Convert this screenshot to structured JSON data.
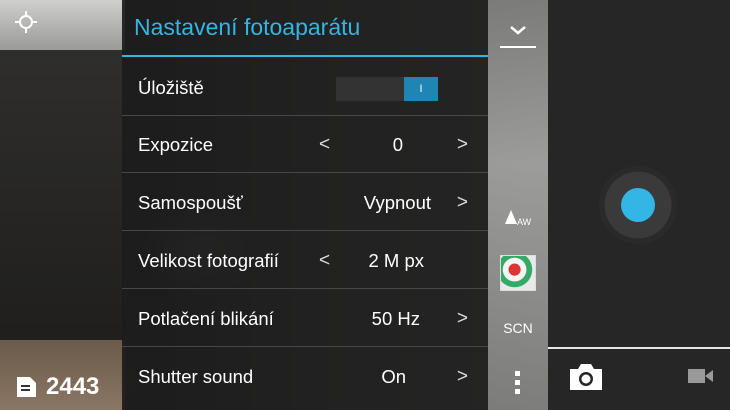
{
  "panel": {
    "title": "Nastavení fotoaparátu",
    "rows": [
      {
        "label": "Úložiště",
        "control": "switch",
        "switch_text": "I"
      },
      {
        "label": "Expozice",
        "value": "0",
        "prev": "<",
        "next": ">"
      },
      {
        "label": "Samospoušť",
        "value": "Vypnout",
        "next": ">"
      },
      {
        "label": "Velikost fotografií",
        "value": "2 M px",
        "prev": "<"
      },
      {
        "label": "Potlačení blikání",
        "value": "50 Hz",
        "next": ">"
      },
      {
        "label": "Shutter sound",
        "value": "On",
        "next": ">"
      }
    ]
  },
  "status": {
    "remaining_shots": "2443"
  },
  "strip": {
    "scene_label": "SCN",
    "white_balance_label": "AW"
  },
  "colors": {
    "accent": "#33b5e5",
    "panel_bg": "#1c1c1c"
  },
  "icons": [
    "focus-icon",
    "sd-card-icon",
    "chevron-down-icon",
    "white-balance-icon",
    "color-effect-thumbnail",
    "more-options-icon",
    "shutter-button",
    "camera-icon",
    "video-icon"
  ]
}
